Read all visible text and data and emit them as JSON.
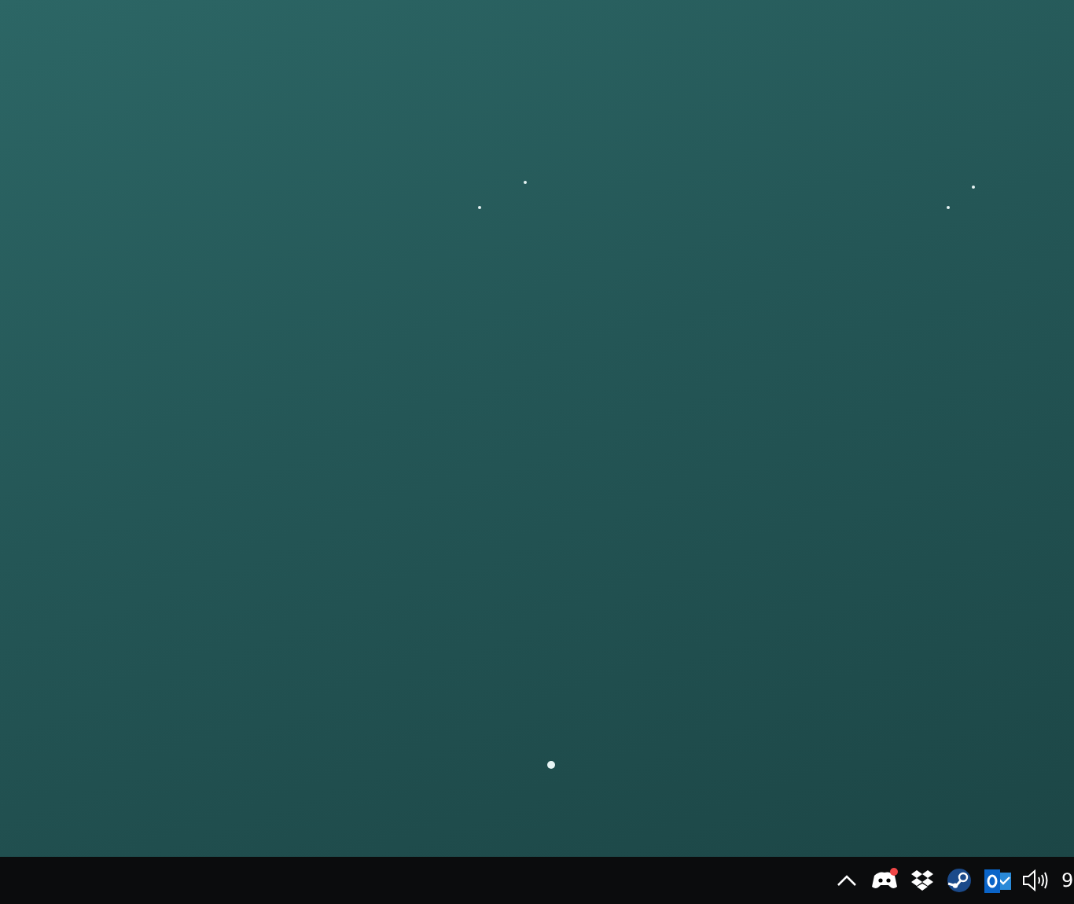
{
  "taskbar": {
    "tray_icons": [
      {
        "kind": "chevron",
        "badge": false
      },
      {
        "kind": "gamepad",
        "badge": true
      },
      {
        "kind": "dropbox",
        "badge": false
      },
      {
        "kind": "steam",
        "badge": false
      },
      {
        "kind": "mail",
        "badge": false
      },
      {
        "kind": "speaker",
        "badge": false
      }
    ],
    "clock": "9"
  }
}
